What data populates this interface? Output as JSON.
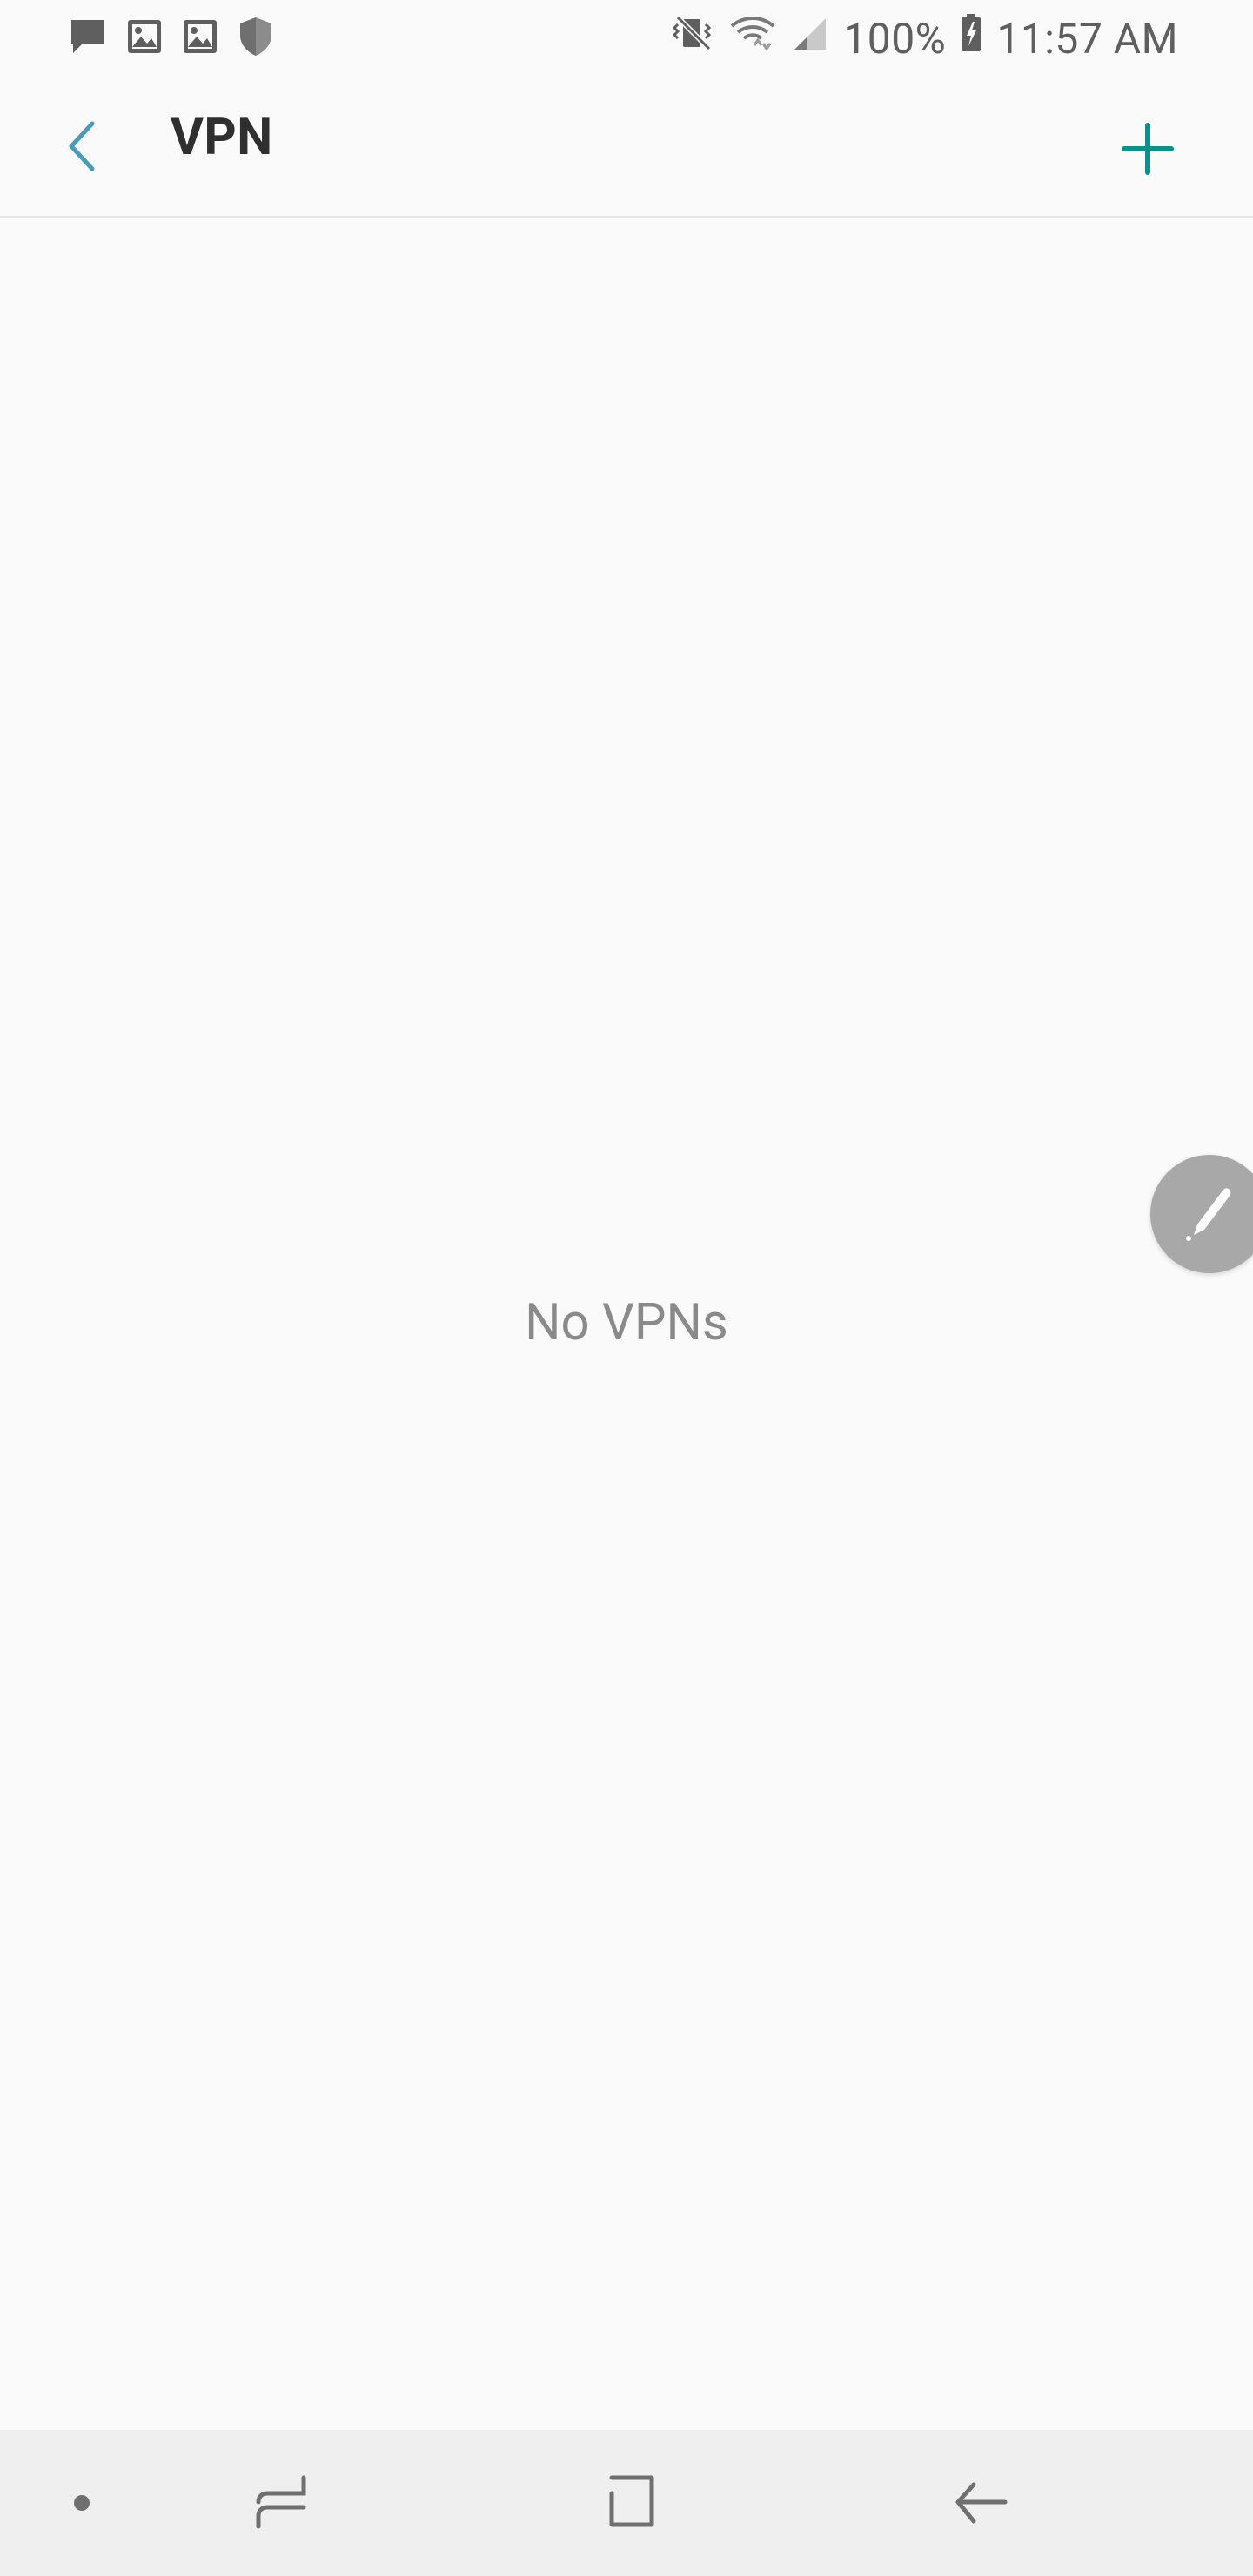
{
  "status_bar": {
    "battery": "100%",
    "time": "11:57 AM",
    "left_icons": [
      "message-icon",
      "image-icon",
      "image-icon",
      "shield-icon"
    ],
    "right_icons": [
      "mute-vibrate-icon",
      "wifi-icon",
      "signal-icon",
      "battery-charging-icon"
    ]
  },
  "app_bar": {
    "title": "VPN",
    "back_icon": "chevron-left-icon",
    "add_icon": "plus-icon"
  },
  "content": {
    "empty_message": "No VPNs"
  },
  "floating": {
    "edit_icon": "pen-icon"
  },
  "nav_bar": {
    "items": [
      "dot-icon",
      "recents-icon",
      "home-icon",
      "back-icon"
    ]
  },
  "colors": {
    "accent_teal": "#0f8f8a",
    "back_blue": "#4a9bb6",
    "title_text": "#2f2f2f",
    "empty_text": "#8a8a8a",
    "nav_bg": "#efefef",
    "background": "#fafafa"
  }
}
